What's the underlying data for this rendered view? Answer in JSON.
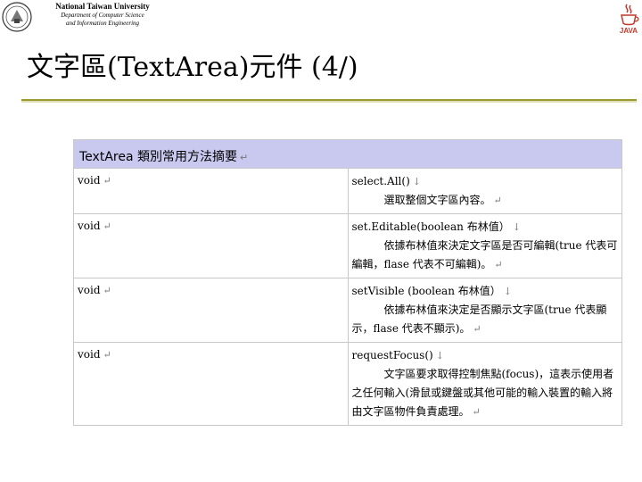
{
  "header": {
    "university": "National Taiwan University",
    "department_line1": "Department of Computer Science",
    "department_line2": "and Information Engineering",
    "logo_text": "JAVA"
  },
  "slide": {
    "title": "文字區(TextArea)元件 (4/)"
  },
  "table": {
    "heading": "TextArea 類別常用方法摘要",
    "rows": [
      {
        "type": "void",
        "signature": "select.All()",
        "description": "選取整個文字區內容。"
      },
      {
        "type": "void",
        "signature": "set.Editable(boolean  布林值）",
        "description": "依據布林值來決定文字區是否可編輯(true 代表可編輯，flase 代表不可編輯)。"
      },
      {
        "type": "void",
        "signature": "setVisible (boolean  布林值）",
        "description": "依據布林值來決定是否顯示文字區(true 代表顯示，flase 代表不顯示)。"
      },
      {
        "type": "void",
        "signature": "requestFocus()",
        "description": "文字區要求取得控制焦點(focus)，這表示使用者之任何輸入(滑鼠或鍵盤或其他可能的輸入裝置的輸入將由文字區物件負責處理。"
      }
    ]
  },
  "colors": {
    "heading_background": "#c9c9f0",
    "rule_line": "#9a9a30",
    "logo_red": "#c0392b"
  }
}
